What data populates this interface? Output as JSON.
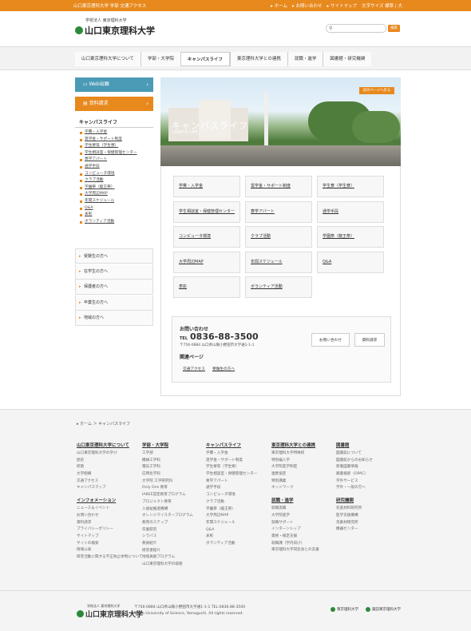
{
  "topbar": {
    "left": "山口東京理科大学 学部 交通アクセス",
    "links": [
      "▸ ホーム",
      "▸ お問い合わせ",
      "▸ サイトマップ",
      "文字サイズ 標準 | 大"
    ]
  },
  "header": {
    "logo_small": "学校法人 東京理科大学",
    "logo_big": "山口東京理科大学",
    "search_placeholder": "",
    "search_button": "検索"
  },
  "nav": [
    "山口東京理科大学について",
    "学部・大学院",
    "キャンパスライフ",
    "東京理科大学との連携",
    "就職・進学",
    "図書館・研究機関"
  ],
  "nav_active": 2,
  "sidebar": {
    "web_label": "Web出願",
    "doc_label": "資料請求",
    "section_title": "キャンパスライフ",
    "items": [
      "学費・入学金",
      "奨学金・サポート制度",
      "学生寮等（学生寮）",
      "学生相談室・保健管理センター",
      "寮学アパート",
      "通学手段",
      "コンピュータ環境",
      "クラブ活動",
      "学園祭（龍王祭）",
      "大学周辺MAP",
      "年間スケジュール",
      "Q&A",
      "表彰",
      "ボランティア活動"
    ],
    "audience": [
      "受験生の方へ",
      "在学生の方へ",
      "保護者の方へ",
      "卒業生の方へ",
      "地域の方へ"
    ]
  },
  "hero": {
    "title": "キャンパスライフ",
    "subtitle": "CAMPUS LIFE",
    "back_button": "前のページへ戻る"
  },
  "tiles": [
    "学費・入学金",
    "奨学金・サポート制度",
    "学生寮（学生寮）",
    "学生相談室・保健管理センター",
    "寮学アパート",
    "通学手段",
    "コンピュータ環境",
    "クラブ活動",
    "学園祭（龍王祭）",
    "大学周辺MAP",
    "年間スケジュール",
    "Q&A",
    "表彰",
    "ボランティア活動"
  ],
  "contact": {
    "heading": "お問い合わせ",
    "tel_label": "TEL",
    "tel": "0836-88-3500",
    "address": "〒756-0884 山口県山陽小野田市大学通1-1-1",
    "btn_contact": "お問い合わせ",
    "btn_doc": "資料請求",
    "related_heading": "関連ページ",
    "related": [
      "交通アクセス",
      "受験生の方へ"
    ]
  },
  "footer": {
    "breadcrumb": "▸ ホーム ＞ キャンパスライフ",
    "columns": [
      {
        "head": "山口東京理科大学について",
        "items": [
          "山口東京理科大学の学び",
          "歴史",
          "校歌",
          "大学組織",
          "交通アクセス",
          "キャンパスマップ"
        ],
        "head2": "インフォメーション",
        "items2": [
          "ニュース＆イベント",
          "お問い合わせ",
          "資料請求",
          "プライバシーポリシー",
          "サイトマップ",
          "サイトの検索",
          "情報公表",
          "研究活動に関する不正防止体制について"
        ]
      },
      {
        "head": "学部・大学院",
        "items": [
          "工学部",
          "機械工学科",
          "電気工学科",
          "応用化学科",
          "大学院 工学研究科",
          "Only One 教育",
          "IABEE認定教育プログラム",
          "プロジェクト教育",
          "入福祉推進機構",
          "オレンジマイスタープログラム",
          "教育のステップ",
          "卒業研究",
          "シラバス",
          "教員紹介",
          "研究者紹介",
          "地域貢献プログラム",
          "山口東京理科大学の取組"
        ]
      },
      {
        "head": "キャンパスライフ",
        "items": [
          "学費・入学金",
          "奨学金・サポート制度",
          "学生寮等（学生寮）",
          "学生相談室・保健管理センター",
          "寮学アパート",
          "通学手段",
          "コンピュータ環境",
          "クラブ活動",
          "学園祭（龍王祭）",
          "大学周辺MAP",
          "年間スケジュール",
          "Q&A",
          "表彰",
          "ボランティア活動"
        ]
      },
      {
        "head": "東京理科大学との連携",
        "items": [
          "東京理科大学特殊校",
          "特別編入学",
          "大学院進学制度",
          "連携協定",
          "特別講義",
          "ネットワーク"
        ],
        "head2": "就職・進学",
        "items2": [
          "就職実績",
          "大学院進学",
          "就職サポート",
          "インターンシップ",
          "資格・検定支援",
          "就職課（学内向け）",
          "東京理科大学同窓会との支援"
        ]
      },
      {
        "head": "図書館",
        "items": [
          "図書館について",
          "図書館からのお知らせ",
          "新着図書情報",
          "蔵書検索（OPAC）",
          "学外サービス",
          "学外・一般の方へ"
        ],
        "head2": "研究機関",
        "items2": [
          "先進材料研究所",
          "医学支援機構",
          "洗素材研究所",
          "機器センター"
        ]
      }
    ],
    "logo_small": "学校法人 東京理科大学",
    "logo_big": "山口東京理科大学",
    "address": "〒756-0884 山口県山陽小野田市大学通1-1-1 TEL:0836-88-3500",
    "copyright": "Tokyo University of Science, Yamaguchi. All rights reserved.",
    "sister1": "東京理科大学",
    "sister2": "諏訪東京理科大学"
  }
}
